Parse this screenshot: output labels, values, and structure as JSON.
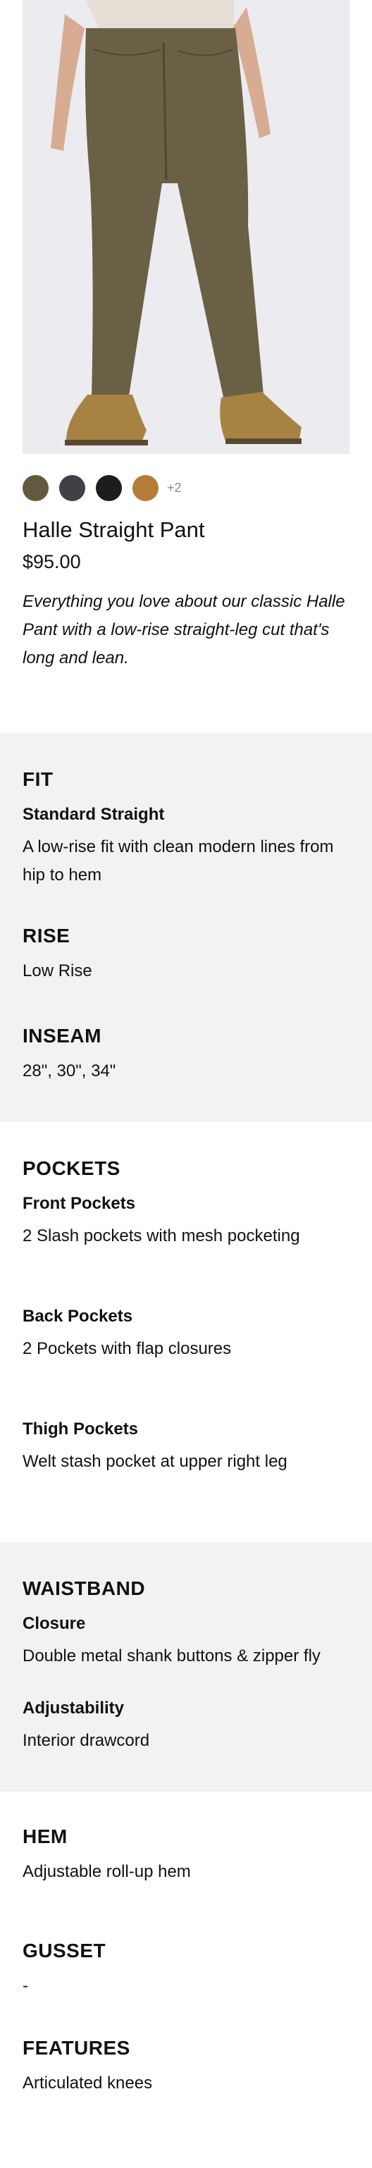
{
  "product": {
    "title": "Halle Straight Pant",
    "price": "$95.00",
    "description": "Everything you love about our classic Halle Pant with a low-rise straight-leg cut that's long and lean.",
    "image_icon": "product-photo",
    "swatches": [
      {
        "color": "#625a3f"
      },
      {
        "color": "#3f4147"
      },
      {
        "color": "#1d1d1f"
      },
      {
        "color": "#b57c3a"
      }
    ],
    "more_colors": "+2"
  },
  "fit": {
    "heading": "FIT",
    "subheading": "Standard Straight",
    "text": "A low-rise fit with clean modern lines from hip to hem"
  },
  "rise": {
    "heading": "RISE",
    "text": "Low Rise"
  },
  "inseam": {
    "heading": "INSEAM",
    "text": "28\", 30\", 34\""
  },
  "pockets": {
    "heading": "POCKETS",
    "items": [
      {
        "label": "Front Pockets",
        "text": "2 Slash pockets with mesh pocketing"
      },
      {
        "label": "Back Pockets",
        "text": "2 Pockets with flap closures"
      },
      {
        "label": "Thigh Pockets",
        "text": "Welt stash pocket at upper right leg"
      }
    ]
  },
  "waistband": {
    "heading": "WAISTBAND",
    "items": [
      {
        "label": "Closure",
        "text": "Double metal shank buttons & zipper fly"
      },
      {
        "label": "Adjustability",
        "text": "Interior drawcord"
      }
    ]
  },
  "hem": {
    "heading": "HEM",
    "text": "Adjustable roll-up hem"
  },
  "gusset": {
    "heading": "GUSSET",
    "text": "-"
  },
  "features": {
    "heading": "FEATURES",
    "text": "Articulated knees"
  }
}
